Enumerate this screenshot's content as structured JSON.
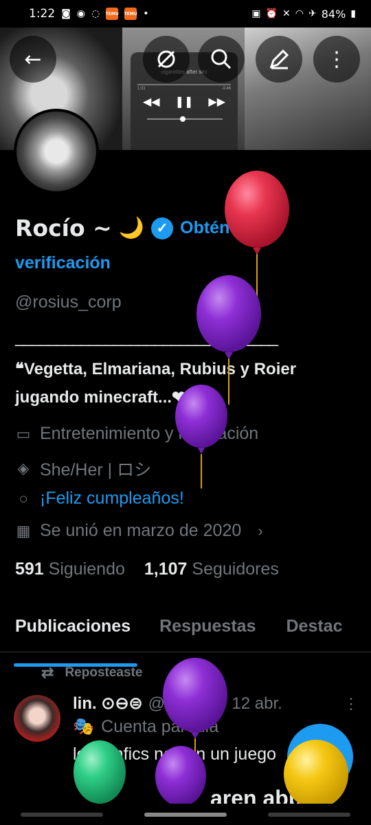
{
  "status_bar": {
    "time": "1:22",
    "battery": "84%"
  },
  "banner": {
    "player_track": "cigarettes after sex",
    "player_elapsed": "1:31",
    "player_remaining": "-3:46"
  },
  "profile": {
    "name": "Rocío ~",
    "name_emoji": "🌙",
    "verify_prompt_1": "Obtén la",
    "verify_prompt_2": "verificación",
    "handle": "@rosius_corp",
    "divider": "________________________________",
    "bio": "❝Vegetta, Elmariana, Rubius y Roier jugando minecraft...❤",
    "category": "Entretenimiento y recreación",
    "location": "She/Her | ロシ",
    "birthday": "¡Feliz cumpleaños!",
    "joined": "Se unió en marzo de 2020",
    "following_count": "591",
    "following_label": "Siguiendo",
    "followers_count": "1,107",
    "followers_label": "Seguidores"
  },
  "tabs": [
    "Publicaciones",
    "Respuestas",
    "Destac"
  ],
  "post": {
    "repost_label": "Reposteaste",
    "author_name": "lin. ⊙⊖⊜",
    "author_handle": "@ninihys",
    "date": "· 12 abr.",
    "parody_label": "Cuenta parodia",
    "text": "los fanfics no son un juego",
    "text_fragment": "aren abbe"
  },
  "colors": {
    "accent": "#1d9bf0",
    "muted": "#71767b",
    "text": "#e7e9ea",
    "background": "#000000"
  },
  "icons": {
    "back": "arrow-left-icon",
    "grok": "grok-icon",
    "search": "search-icon",
    "edit": "edit-icon",
    "more": "more-vertical-icon",
    "category": "briefcase-icon",
    "location": "location-pin-icon",
    "birthday": "balloon-icon",
    "joined": "calendar-icon",
    "repost": "repost-icon",
    "fab": "plus-icon"
  }
}
